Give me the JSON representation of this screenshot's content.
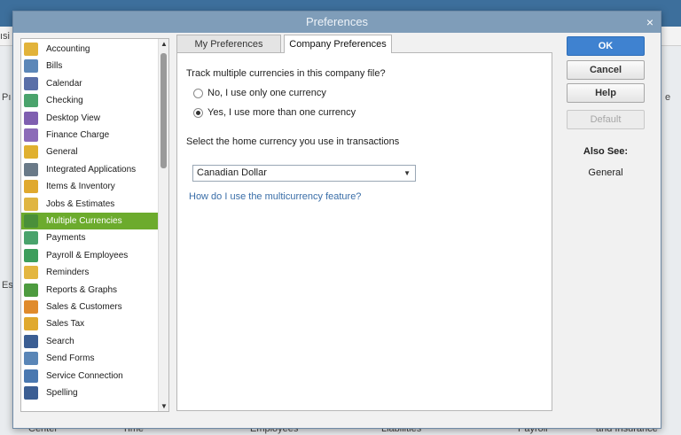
{
  "dialog": {
    "title": "Preferences",
    "close_glyph": "×"
  },
  "nav": {
    "items": [
      {
        "label": "Accounting",
        "icon": "accounting-icon",
        "color": "#e2b33a"
      },
      {
        "label": "Bills",
        "icon": "bills-icon",
        "color": "#5c87b8"
      },
      {
        "label": "Calendar",
        "icon": "calendar-icon",
        "color": "#5a6fa8"
      },
      {
        "label": "Checking",
        "icon": "checking-icon",
        "color": "#4aa36c"
      },
      {
        "label": "Desktop View",
        "icon": "desktop-view-icon",
        "color": "#7f5fb0"
      },
      {
        "label": "Finance Charge",
        "icon": "finance-charge-icon",
        "color": "#8c6bb8"
      },
      {
        "label": "General",
        "icon": "general-icon",
        "color": "#e0b02f"
      },
      {
        "label": "Integrated Applications",
        "icon": "integrated-apps-icon",
        "color": "#6a7a88"
      },
      {
        "label": "Items & Inventory",
        "icon": "items-inventory-icon",
        "color": "#e0a92e"
      },
      {
        "label": "Jobs & Estimates",
        "icon": "jobs-estimates-icon",
        "color": "#e0b542"
      },
      {
        "label": "Multiple Currencies",
        "icon": "multiple-currencies-icon",
        "color": "#4a8f3a",
        "selected": true
      },
      {
        "label": "Payments",
        "icon": "payments-icon",
        "color": "#4aa36c"
      },
      {
        "label": "Payroll & Employees",
        "icon": "payroll-employees-icon",
        "color": "#3d9e5c"
      },
      {
        "label": "Reminders",
        "icon": "reminders-icon",
        "color": "#e3b640"
      },
      {
        "label": "Reports & Graphs",
        "icon": "reports-graphs-icon",
        "color": "#4d9b3f"
      },
      {
        "label": "Sales & Customers",
        "icon": "sales-customers-icon",
        "color": "#e08b2c"
      },
      {
        "label": "Sales Tax",
        "icon": "sales-tax-icon",
        "color": "#e0a92e"
      },
      {
        "label": "Search",
        "icon": "search-icon",
        "color": "#3b5e93"
      },
      {
        "label": "Send Forms",
        "icon": "send-forms-icon",
        "color": "#5a86b7"
      },
      {
        "label": "Service Connection",
        "icon": "service-connection-icon",
        "color": "#4a78b0"
      },
      {
        "label": "Spelling",
        "icon": "spelling-icon",
        "color": "#3b5e93"
      }
    ],
    "scroll_up": "▲",
    "scroll_down": "▼"
  },
  "tabs": {
    "my": "My Preferences",
    "company": "Company Preferences"
  },
  "panel": {
    "question": "Track multiple currencies in this company file?",
    "option_no": "No, I use only one currency",
    "option_yes": "Yes, I use more than one currency",
    "home_label": "Select the home currency you use in transactions",
    "home_value": "Canadian Dollar",
    "select_caret": "▼",
    "help_link": "How do I use the multicurrency feature?"
  },
  "buttons": {
    "ok": "OK",
    "cancel": "Cancel",
    "help": "Help",
    "default": "Default"
  },
  "also_see": {
    "title": "Also See:",
    "link": "General"
  },
  "background": {
    "frag1": "ısi",
    "frag2": "Pı",
    "frag3": "Es",
    "frag4": "e",
    "frag5": "Center",
    "frag6": "Time",
    "frag7": "Employees",
    "frag8": "Liabilities",
    "frag9": "Payroll",
    "frag10": "and Insurance"
  },
  "colors": {
    "selected": "#6cab2d",
    "primary_button": "#3f82d0",
    "titlebar": "#7f9db9"
  }
}
